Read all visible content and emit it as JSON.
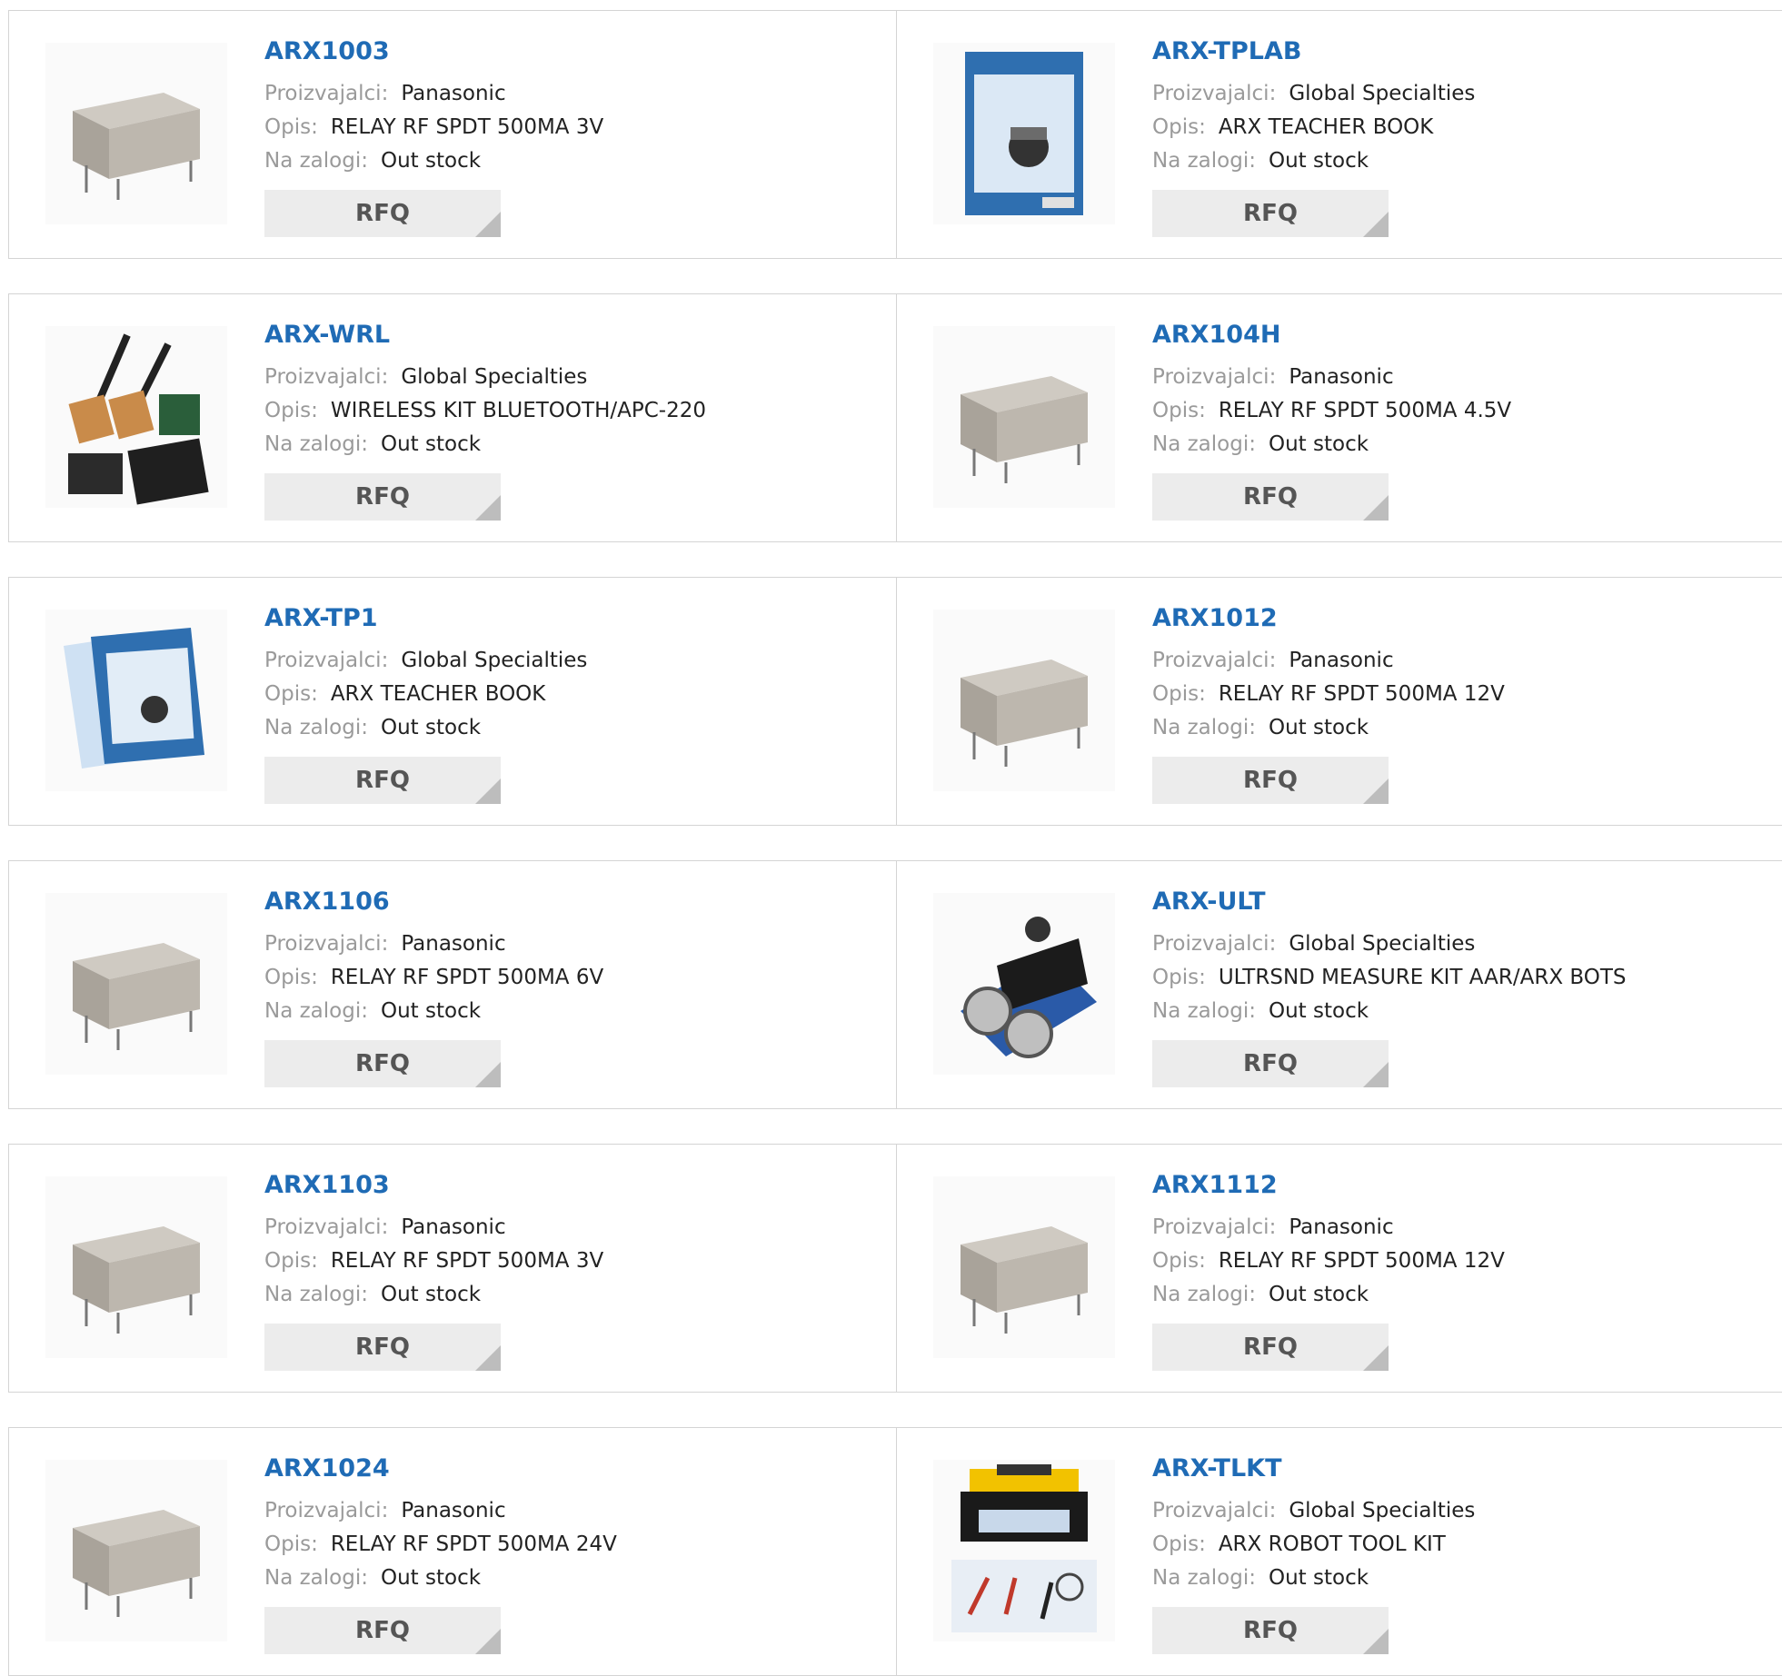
{
  "labels": {
    "manufacturer": "Proizvajalci:",
    "description": "Opis:",
    "stock": "Na zalogi:"
  },
  "rfq_label": "RFQ",
  "accent_color": "#1f6bb5",
  "products": [
    {
      "part": "ARX1003",
      "manufacturer": "Panasonic",
      "description": "RELAY RF SPDT 500MA 3V",
      "stock": "Out stock",
      "image": "relay-image"
    },
    {
      "part": "ARX-TPLAB",
      "manufacturer": "Global Specialties",
      "description": "ARX TEACHER BOOK",
      "stock": "Out stock",
      "image": "book-image"
    },
    {
      "part": "ARX-WRL",
      "manufacturer": "Global Specialties",
      "description": "WIRELESS KIT BLUETOOTH/APC-220",
      "stock": "Out stock",
      "image": "wireless-kit-image"
    },
    {
      "part": "ARX104H",
      "manufacturer": "Panasonic",
      "description": "RELAY RF SPDT 500MA 4.5V",
      "stock": "Out stock",
      "image": "relay-image"
    },
    {
      "part": "ARX-TP1",
      "manufacturer": "Global Specialties",
      "description": "ARX TEACHER BOOK",
      "stock": "Out stock",
      "image": "books-image"
    },
    {
      "part": "ARX1012",
      "manufacturer": "Panasonic",
      "description": "RELAY RF SPDT 500MA 12V",
      "stock": "Out stock",
      "image": "relay-image"
    },
    {
      "part": "ARX1106",
      "manufacturer": "Panasonic",
      "description": "RELAY RF SPDT 500MA 6V",
      "stock": "Out stock",
      "image": "relay-image"
    },
    {
      "part": "ARX-ULT",
      "manufacturer": "Global Specialties",
      "description": "ULTRSND MEASURE KIT AAR/ARX BOTS",
      "stock": "Out stock",
      "image": "ultrasonic-kit-image"
    },
    {
      "part": "ARX1103",
      "manufacturer": "Panasonic",
      "description": "RELAY RF SPDT 500MA 3V",
      "stock": "Out stock",
      "image": "relay-image"
    },
    {
      "part": "ARX1112",
      "manufacturer": "Panasonic",
      "description": "RELAY RF SPDT 500MA 12V",
      "stock": "Out stock",
      "image": "relay-image"
    },
    {
      "part": "ARX1024",
      "manufacturer": "Panasonic",
      "description": "RELAY RF SPDT 500MA 24V",
      "stock": "Out stock",
      "image": "relay-image"
    },
    {
      "part": "ARX-TLKT",
      "manufacturer": "Global Specialties",
      "description": "ARX ROBOT TOOL KIT",
      "stock": "Out stock",
      "image": "tool-kit-image"
    }
  ]
}
